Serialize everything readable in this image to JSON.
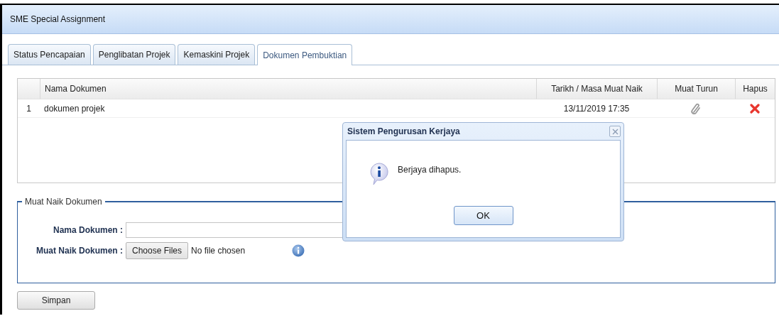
{
  "window": {
    "title": "SME Special Assignment"
  },
  "tabs": [
    {
      "label": "Status Pencapaian",
      "selected": false
    },
    {
      "label": "Penglibatan Projek",
      "selected": false
    },
    {
      "label": "Kemaskini Projek",
      "selected": false
    },
    {
      "label": "Dokumen Pembuktian",
      "selected": true
    }
  ],
  "table": {
    "columns": [
      "Nama Dokumen",
      "Tarikh / Masa Muat Naik",
      "Muat Turun",
      "Hapus"
    ],
    "rows": [
      {
        "index": "1",
        "name": "dokumen projek",
        "uploaded": "13/11/2019 17:35"
      }
    ]
  },
  "upload_form": {
    "legend": "Muat Naik Dokumen",
    "name_label": "Nama Dokumen :",
    "file_label": "Muat Naik Dokumen :",
    "file_button": "Choose Files",
    "file_status": "No file chosen"
  },
  "save_button": "Simpan",
  "dialog": {
    "title": "Sistem Pengurusan Kerjaya",
    "message": "Berjaya dihapus.",
    "button": "OK"
  }
}
